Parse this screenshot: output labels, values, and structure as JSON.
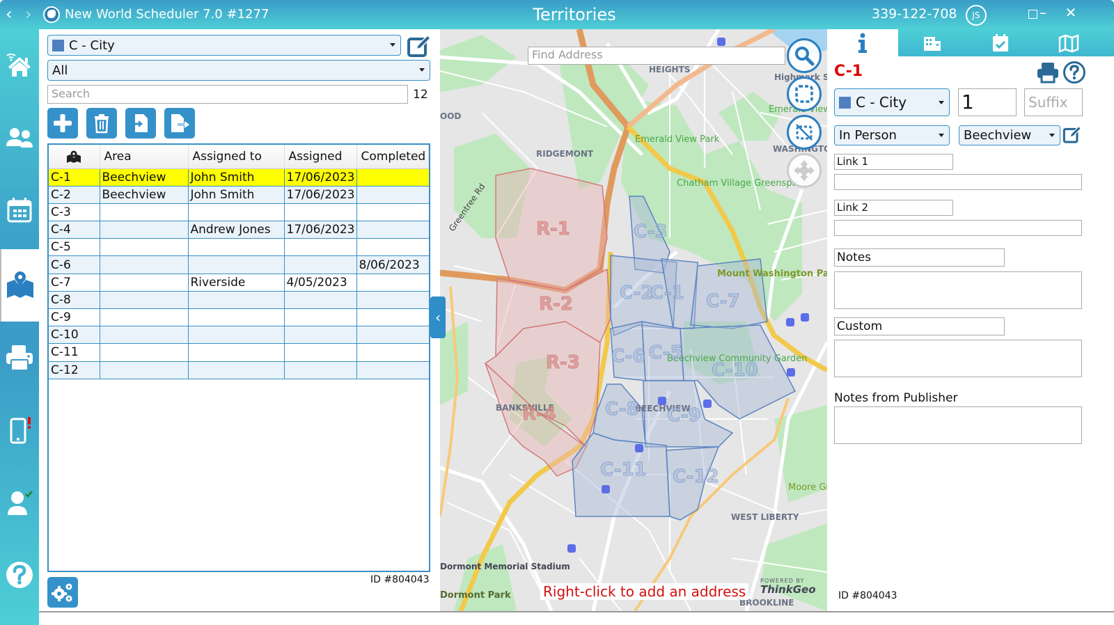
{
  "window": {
    "app_title": "New World Scheduler 7.0 #1277",
    "page_title": "Territories",
    "phone": "339-122-708",
    "user_initials": "JS",
    "back_icon": "‹",
    "forward_icon": "›",
    "minimize_icon": "–",
    "close_icon": "✕"
  },
  "sidebar": {
    "items": [
      {
        "name": "home",
        "icon": "home-wifi-icon"
      },
      {
        "name": "publishers",
        "icon": "people-icon"
      },
      {
        "name": "calendar",
        "icon": "calendar-icon"
      },
      {
        "name": "territories",
        "icon": "map-pin-icon",
        "active": true
      },
      {
        "name": "print",
        "icon": "printer-icon"
      },
      {
        "name": "mobile",
        "icon": "mobile-alert-icon"
      },
      {
        "name": "user",
        "icon": "user-check-icon"
      },
      {
        "name": "help",
        "icon": "help-icon"
      }
    ]
  },
  "left_panel": {
    "type_select": {
      "value": "C - City",
      "swatch_color": "#4f7fbf"
    },
    "filter_select": {
      "value": "All"
    },
    "search": {
      "placeholder": "Search",
      "value": ""
    },
    "count": "12",
    "toolbar": [
      {
        "name": "add",
        "icon": "plus-icon"
      },
      {
        "name": "delete",
        "icon": "trash-icon"
      },
      {
        "name": "import",
        "icon": "import-icon"
      },
      {
        "name": "export",
        "icon": "export-icon"
      }
    ],
    "table": {
      "columns": [
        "",
        "Area",
        "Assigned to",
        "Assigned",
        "Completed"
      ],
      "rows": [
        {
          "id": "C-1",
          "area": "Beechview",
          "assigned_to": "John Smith",
          "assigned": "17/06/2023",
          "completed": "",
          "selected": true
        },
        {
          "id": "C-2",
          "area": "Beechview",
          "assigned_to": "John Smith",
          "assigned": "17/06/2023",
          "completed": ""
        },
        {
          "id": "C-3",
          "area": "",
          "assigned_to": "",
          "assigned": "",
          "completed": ""
        },
        {
          "id": "C-4",
          "area": "",
          "assigned_to": "Andrew Jones",
          "assigned": "17/06/2023",
          "completed": ""
        },
        {
          "id": "C-5",
          "area": "",
          "assigned_to": "",
          "assigned": "",
          "completed": ""
        },
        {
          "id": "C-6",
          "area": "",
          "assigned_to": "",
          "assigned": "",
          "completed": "8/06/2023"
        },
        {
          "id": "C-7",
          "area": "",
          "assigned_to": "Riverside",
          "assigned": "4/05/2023",
          "completed": ""
        },
        {
          "id": "C-8",
          "area": "",
          "assigned_to": "",
          "assigned": "",
          "completed": ""
        },
        {
          "id": "C-9",
          "area": "",
          "assigned_to": "",
          "assigned": "",
          "completed": ""
        },
        {
          "id": "C-10",
          "area": "",
          "assigned_to": "",
          "assigned": "",
          "completed": ""
        },
        {
          "id": "C-11",
          "area": "",
          "assigned_to": "",
          "assigned": "",
          "completed": ""
        },
        {
          "id": "C-12",
          "area": "",
          "assigned_to": "",
          "assigned": "",
          "completed": ""
        }
      ]
    },
    "id_text": "ID #804043"
  },
  "map": {
    "find_address_placeholder": "Find Address",
    "hint": "Right-click to add an address",
    "powered_by": "POWERED BY",
    "provider": "ThinkGeo",
    "place_labels": [
      {
        "text": "HEIGHTS",
        "kind": "area"
      },
      {
        "text": "RIDGEMONT",
        "kind": "area"
      },
      {
        "text": "OOD",
        "kind": "area"
      },
      {
        "text": "WASHINGTO",
        "kind": "area"
      },
      {
        "text": "BANKSVILLE",
        "kind": "area"
      },
      {
        "text": "BEECHVIEW",
        "kind": "area"
      },
      {
        "text": "WEST LIBERTY",
        "kind": "area"
      },
      {
        "text": "BROOKLINE",
        "kind": "area"
      },
      {
        "text": "Highmark Sta",
        "kind": "poi"
      },
      {
        "text": "Emerald View Park",
        "kind": "park"
      },
      {
        "text": "Emerald View",
        "kind": "park"
      },
      {
        "text": "Chatham Village Greenspace",
        "kind": "park"
      },
      {
        "text": "Mount Washington Park",
        "kind": "park"
      },
      {
        "text": "Beechview Community Garden",
        "kind": "park"
      },
      {
        "text": "Moore Gr",
        "kind": "park"
      },
      {
        "text": "Dormont Memorial Stadium",
        "kind": "poi"
      },
      {
        "text": "Dormont Park",
        "kind": "park"
      },
      {
        "text": "Greentree Rd",
        "kind": "road"
      }
    ],
    "territories": [
      {
        "label": "R-1",
        "group": "R"
      },
      {
        "label": "R-2",
        "group": "R"
      },
      {
        "label": "R-3",
        "group": "R"
      },
      {
        "label": "R-4",
        "group": "R"
      },
      {
        "label": "C-1",
        "group": "C"
      },
      {
        "label": "C-2",
        "group": "C"
      },
      {
        "label": "C-3",
        "group": "C"
      },
      {
        "label": "C-5",
        "group": "C"
      },
      {
        "label": "C-6",
        "group": "C"
      },
      {
        "label": "C-7",
        "group": "C"
      },
      {
        "label": "C-8",
        "group": "C"
      },
      {
        "label": "C-9",
        "group": "C"
      },
      {
        "label": "C-10",
        "group": "C"
      },
      {
        "label": "C-11",
        "group": "C"
      },
      {
        "label": "C-12",
        "group": "C"
      }
    ],
    "controls": [
      "zoom-search",
      "select-area",
      "clear-selection",
      "pan"
    ]
  },
  "right_panel": {
    "tabs": [
      {
        "name": "info",
        "icon": "info-icon",
        "active": true
      },
      {
        "name": "buildings",
        "icon": "building-icon"
      },
      {
        "name": "assignments",
        "icon": "calendar-check-icon"
      },
      {
        "name": "map",
        "icon": "map-icon"
      }
    ],
    "territory_title": "C-1",
    "type_select": {
      "value": "C - City",
      "swatch_color": "#4f7fbf"
    },
    "number": "1",
    "suffix_placeholder": "Suffix",
    "method_select": {
      "value": "In Person"
    },
    "area_select": {
      "value": "Beechview"
    },
    "link1_label": "Link 1",
    "link1_value": "",
    "link2_label": "Link 2",
    "link2_value": "",
    "notes_label": "Notes",
    "notes_value": "",
    "custom_label": "Custom",
    "custom_value": "",
    "publisher_notes_label": "Notes from Publisher",
    "publisher_notes_value": "",
    "id_text": "ID #804043"
  },
  "colors": {
    "accent": "#3591c9",
    "accent_gradient_light": "#4ecfd6",
    "selected_row": "#ffff00",
    "alt_row": "#eaf3fa",
    "title_red": "#e00000",
    "territory_r": "#e8b4b4",
    "territory_c": "#a8b8d8"
  }
}
